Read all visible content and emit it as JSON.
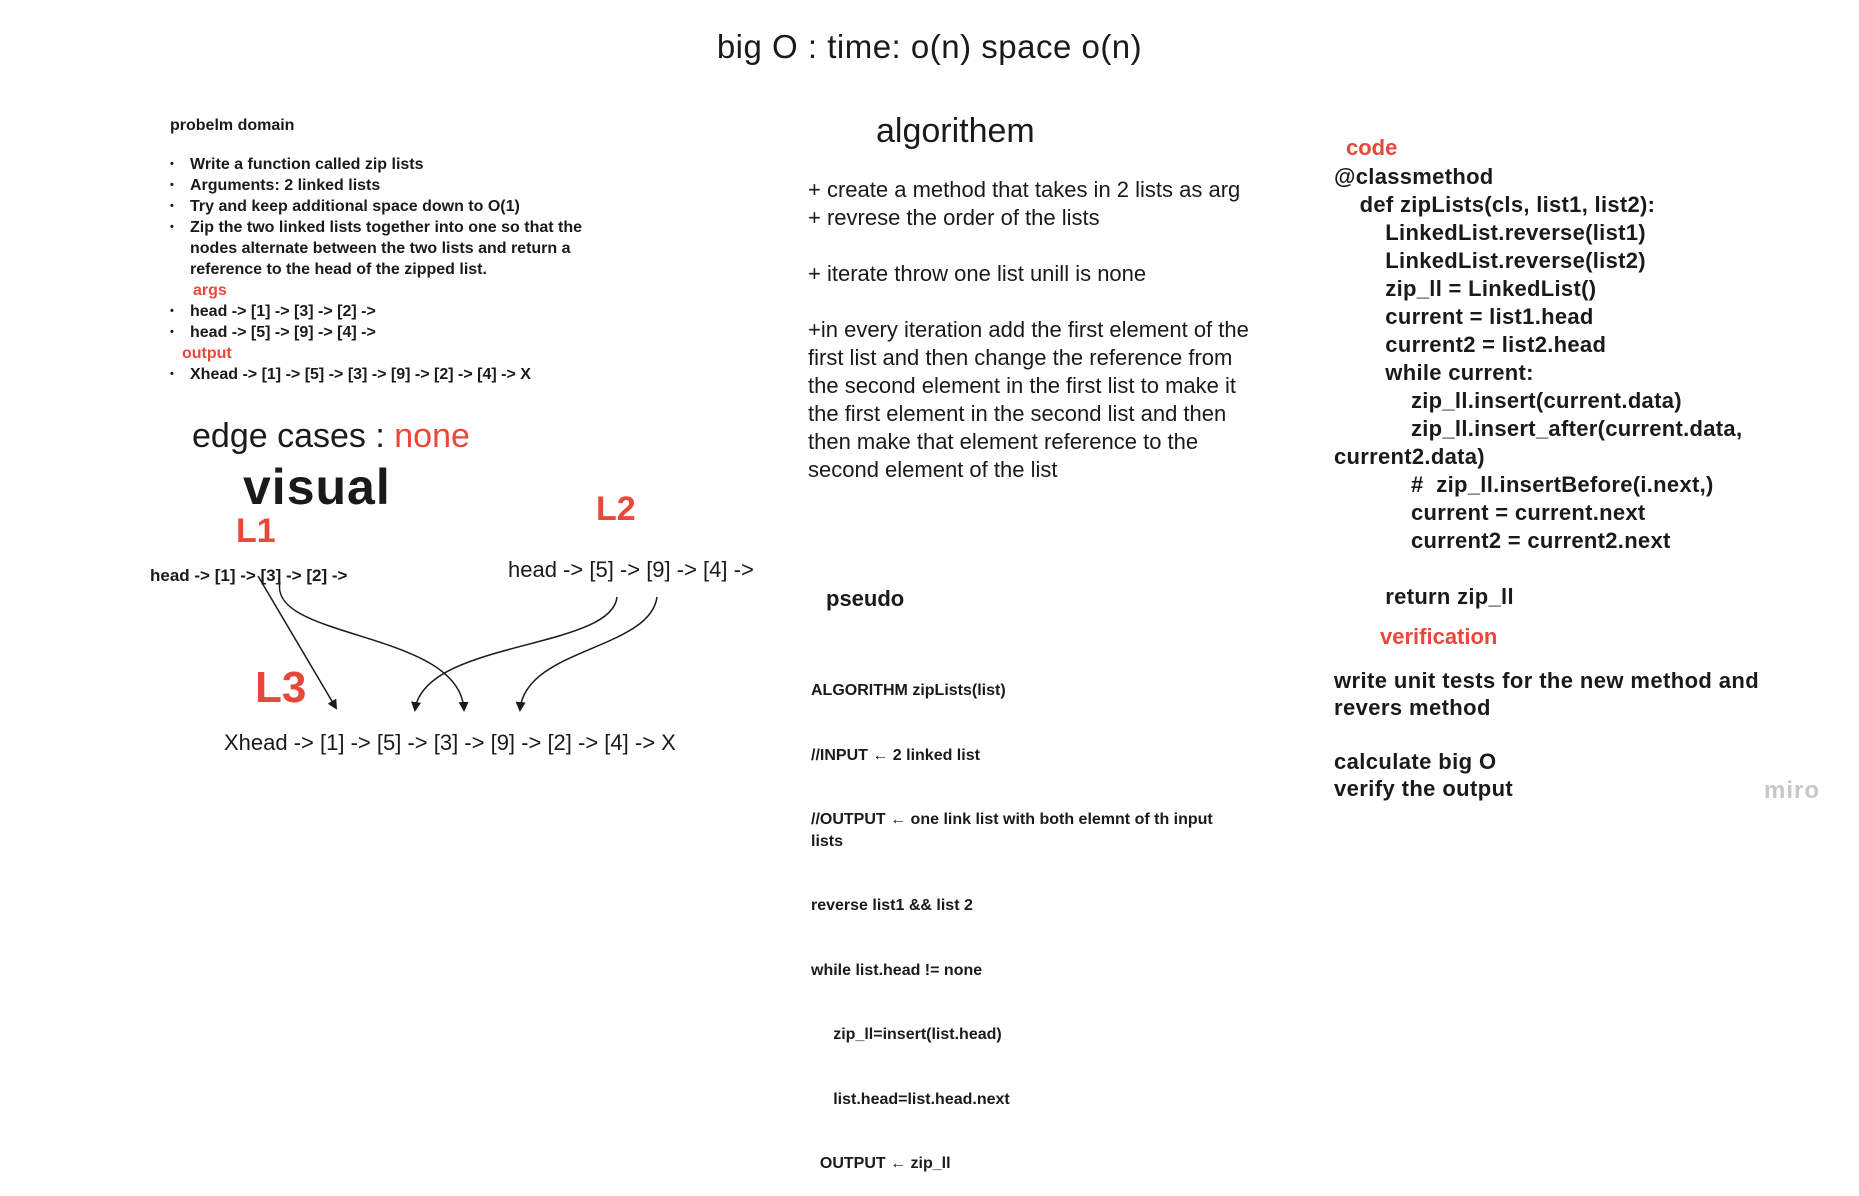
{
  "title": "big O  : time: o(n)  space o(n)",
  "problem": {
    "heading": "probelm domain",
    "bullets": [
      "Write a function called zip lists",
      "Arguments: 2 linked lists",
      "Try and keep additional space down to O(1)",
      "Zip the two linked lists together into one so that the nodes alternate between the two lists and return a reference to the head of the zipped list."
    ],
    "args_label": "args",
    "args": [
      "head -> [1] -> [3] -> [2] ->",
      "head -> [5] -> [9] -> [4] ->"
    ],
    "output_label": "output",
    "output": [
      "Xhead -> [1] -> [5] -> [3] -> [9] -> [2] -> [4] -> X"
    ]
  },
  "edge_cases": {
    "label": "edge cases : ",
    "value": "none"
  },
  "visual": {
    "heading": "visual",
    "l1_label": "L1",
    "l2_label": "L2",
    "l3_label": "L3",
    "list1": "head -> [1] -> [3] -> [2] ->",
    "list2": "head -> [5] -> [9] -> [4] ->",
    "list3": "Xhead -> [1] -> [5] -> [3] -> [9] -> [2] -> [4] -> X"
  },
  "algorithm": {
    "heading": "algorithem",
    "steps": [
      "+ create a method that takes in 2 lists as arg\n+ revrese the order of the lists",
      "+ iterate throw one list unill is none",
      "+in every iteration add the first element of the first list and then change the reference from the second element in the first list to make it the first element in the second list and then then make that element reference to the second element of the list"
    ]
  },
  "pseudo": {
    "heading": "pseudo",
    "lines": [
      "ALGORITHM zipLists(list)",
      "//INPUT ← 2 linked list",
      "//OUTPUT ← one link list  with both elemnt of th input lists",
      "reverse list1 && list 2",
      "while list.head != none",
      "     zip_ll=insert(list.head)",
      "     list.head=list.head.next",
      "  OUTPUT ← zip_ll"
    ]
  },
  "code": {
    "heading": "code",
    "text": "@classmethod\n    def zipLists(cls, list1, list2):\n        LinkedList.reverse(list1)\n        LinkedList.reverse(list2)\n        zip_ll = LinkedList()\n        current = list1.head\n        current2 = list2.head\n        while current:\n            zip_ll.insert(current.data)\n            zip_ll.insert_after(current.data,\ncurrent2.data)\n            #  zip_ll.insertBefore(i.next,)\n            current = current.next\n            current2 = current2.next\n\n        return zip_ll"
  },
  "verification": {
    "heading": "verification",
    "text": "write unit tests for the new method and\nrevers method\n\ncalculate big O\nverify the output"
  },
  "watermark": "miro",
  "colors": {
    "accent": "#e8483a",
    "text": "#1a1a1a"
  }
}
